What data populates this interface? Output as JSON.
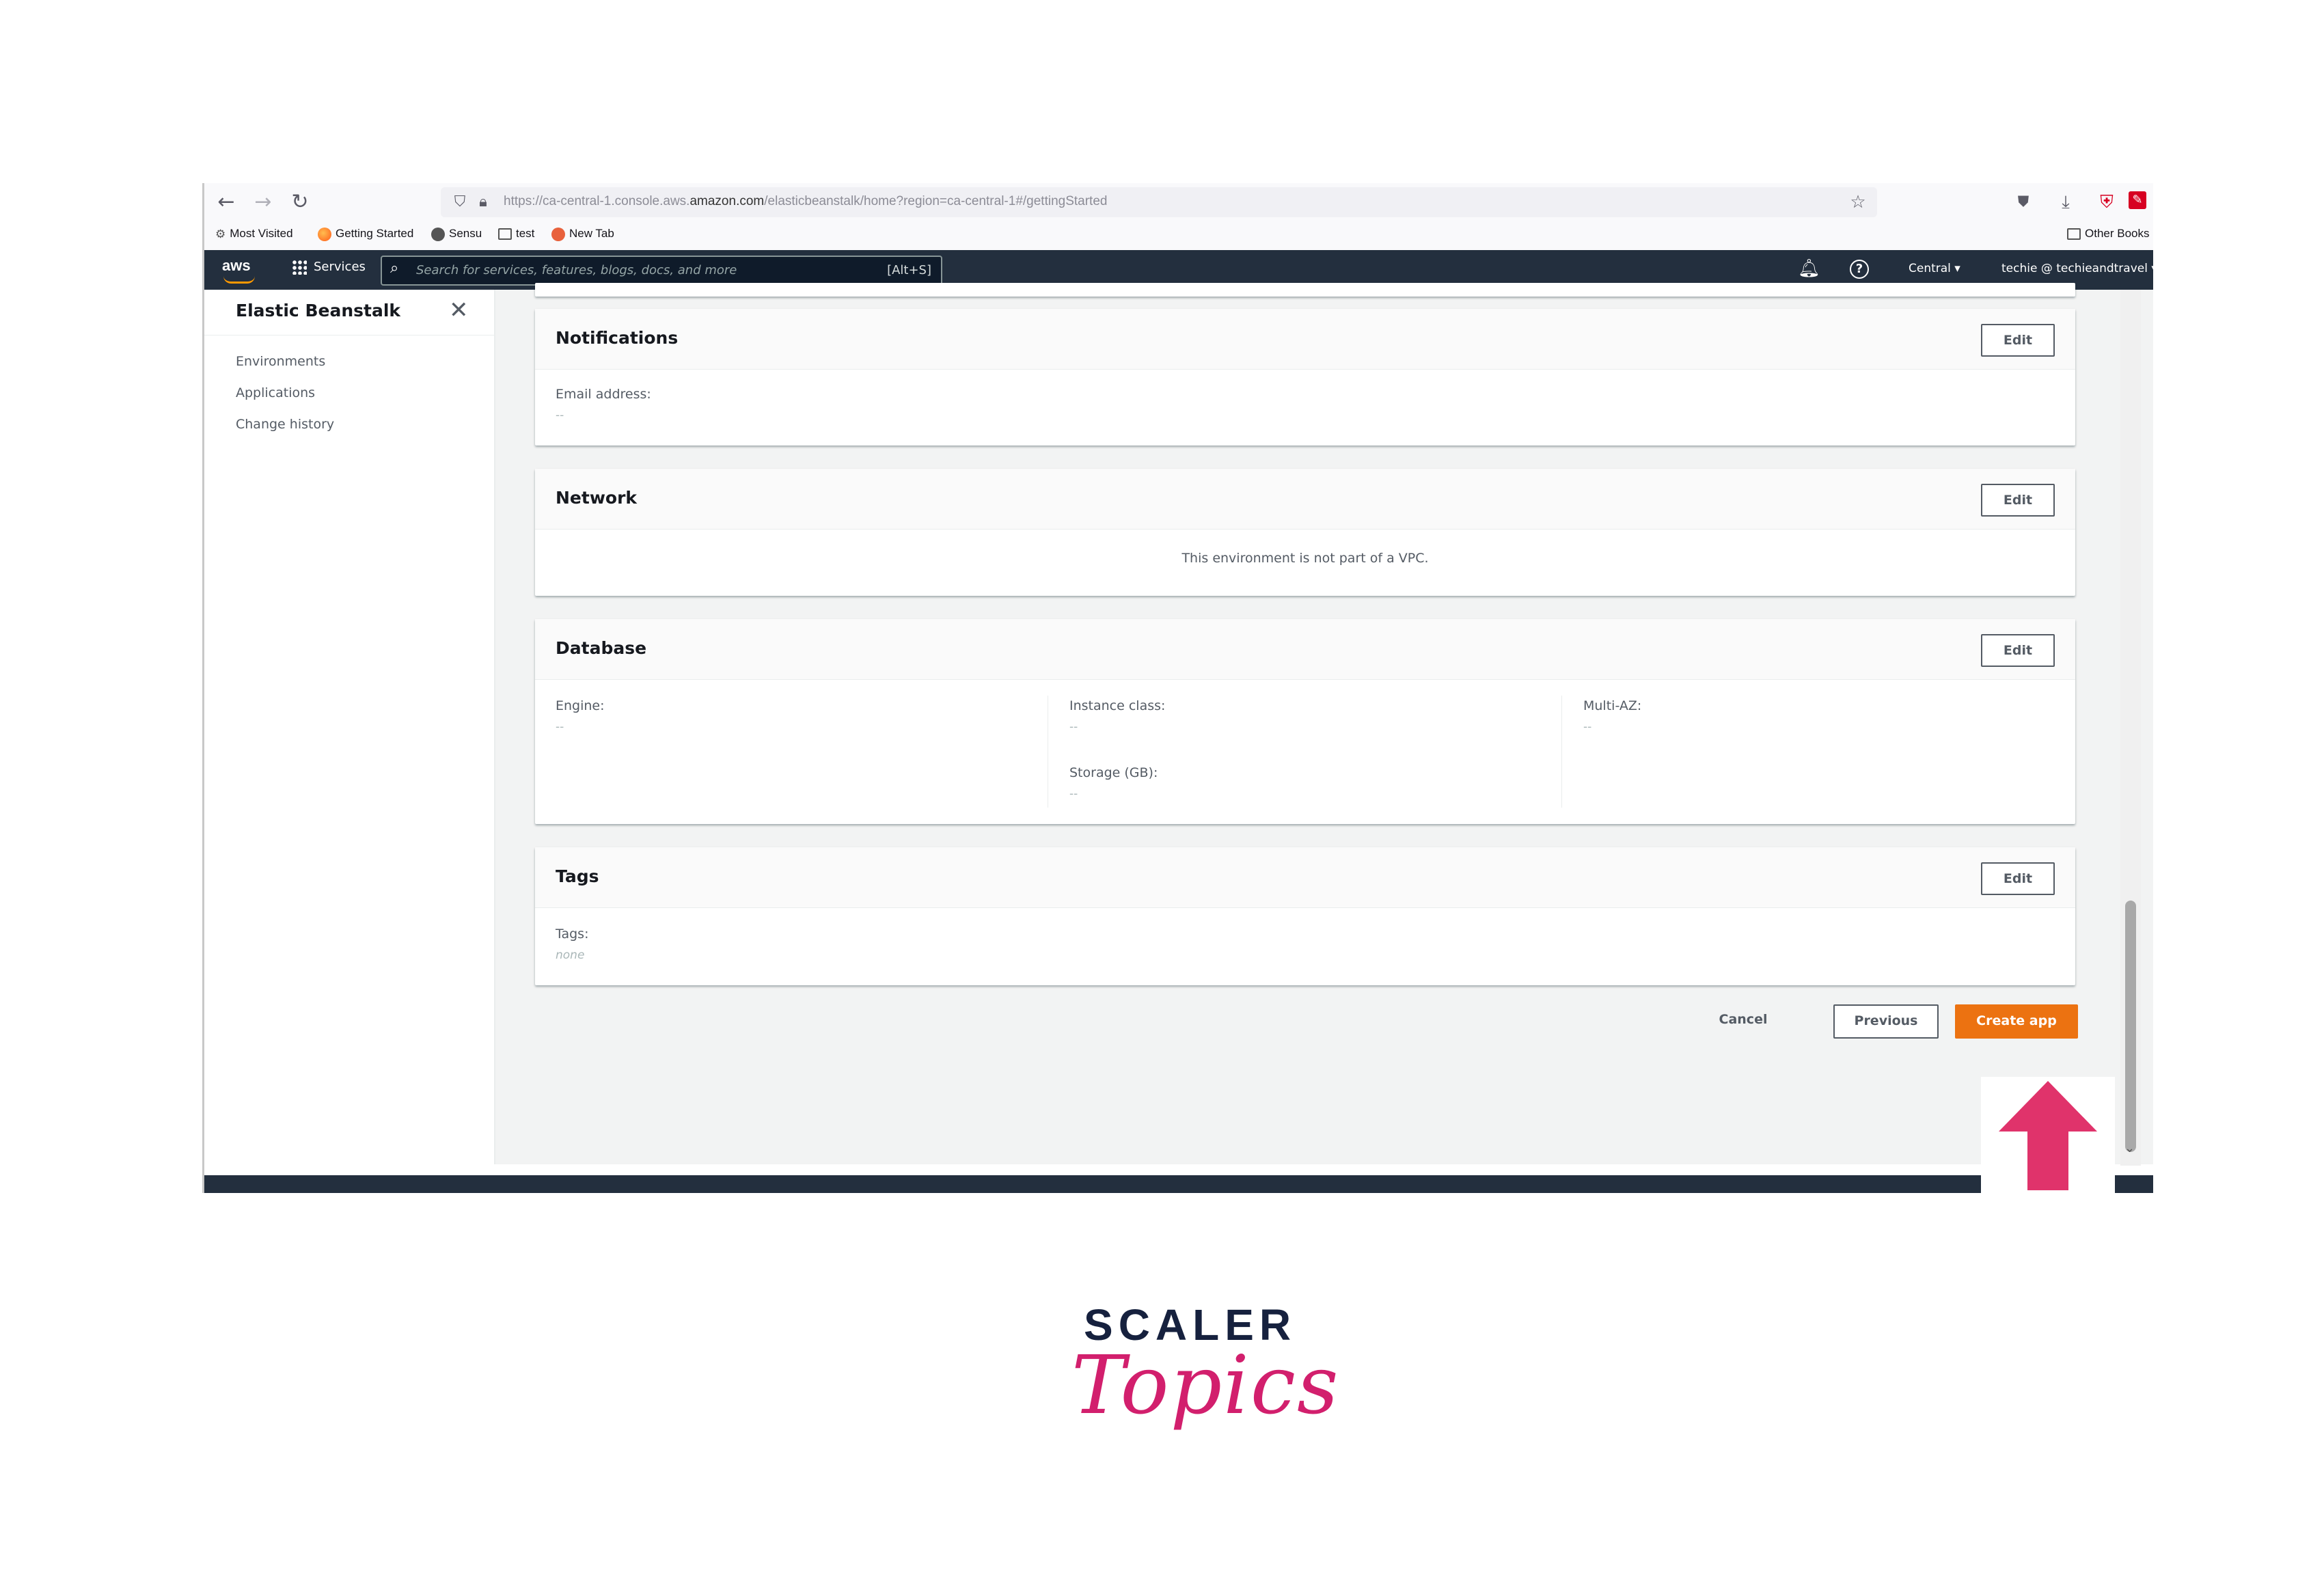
{
  "browser": {
    "url_prefix": "https://ca-central-1.console.aws.",
    "url_domain": "amazon.com",
    "url_suffix": "/elasticbeanstalk/home?region=ca-central-1#/gettingStarted",
    "bookmarks": [
      "Most Visited",
      "Getting Started",
      "Sensu",
      "test",
      "New Tab"
    ],
    "other_bookmarks": "Other Books"
  },
  "aws_header": {
    "logo": "aws",
    "services_label": "Services",
    "search_placeholder": "Search for services, features, blogs, docs, and more",
    "search_shortcut": "[Alt+S]",
    "region": "Central ▾",
    "account": "techie @ techieandtravel ▾"
  },
  "sidebar": {
    "title": "Elastic Beanstalk",
    "items": [
      {
        "label": "Environments"
      },
      {
        "label": "Applications"
      },
      {
        "label": "Change history"
      }
    ]
  },
  "sections": {
    "notifications": {
      "title": "Notifications",
      "edit": "Edit",
      "email_label": "Email address:",
      "email_value": "--"
    },
    "network": {
      "title": "Network",
      "edit": "Edit",
      "message": "This environment is not part of a VPC."
    },
    "database": {
      "title": "Database",
      "edit": "Edit",
      "engine_label": "Engine:",
      "engine_value": "--",
      "instance_class_label": "Instance class:",
      "instance_class_value": "--",
      "storage_label": "Storage (GB):",
      "storage_value": "--",
      "multi_az_label": "Multi-AZ:",
      "multi_az_value": "--"
    },
    "tags": {
      "title": "Tags",
      "edit": "Edit",
      "tags_label": "Tags:",
      "tags_value": "none"
    }
  },
  "actions": {
    "cancel": "Cancel",
    "previous": "Previous",
    "create": "Create app"
  },
  "colors": {
    "aws_header": "#232f3e",
    "primary_button": "#ec7211",
    "arrow": "#e0336b",
    "logo_pink": "#d21f6d",
    "logo_navy": "#16213e"
  },
  "brand": {
    "line1": "SCALER",
    "line2": "Topics"
  }
}
